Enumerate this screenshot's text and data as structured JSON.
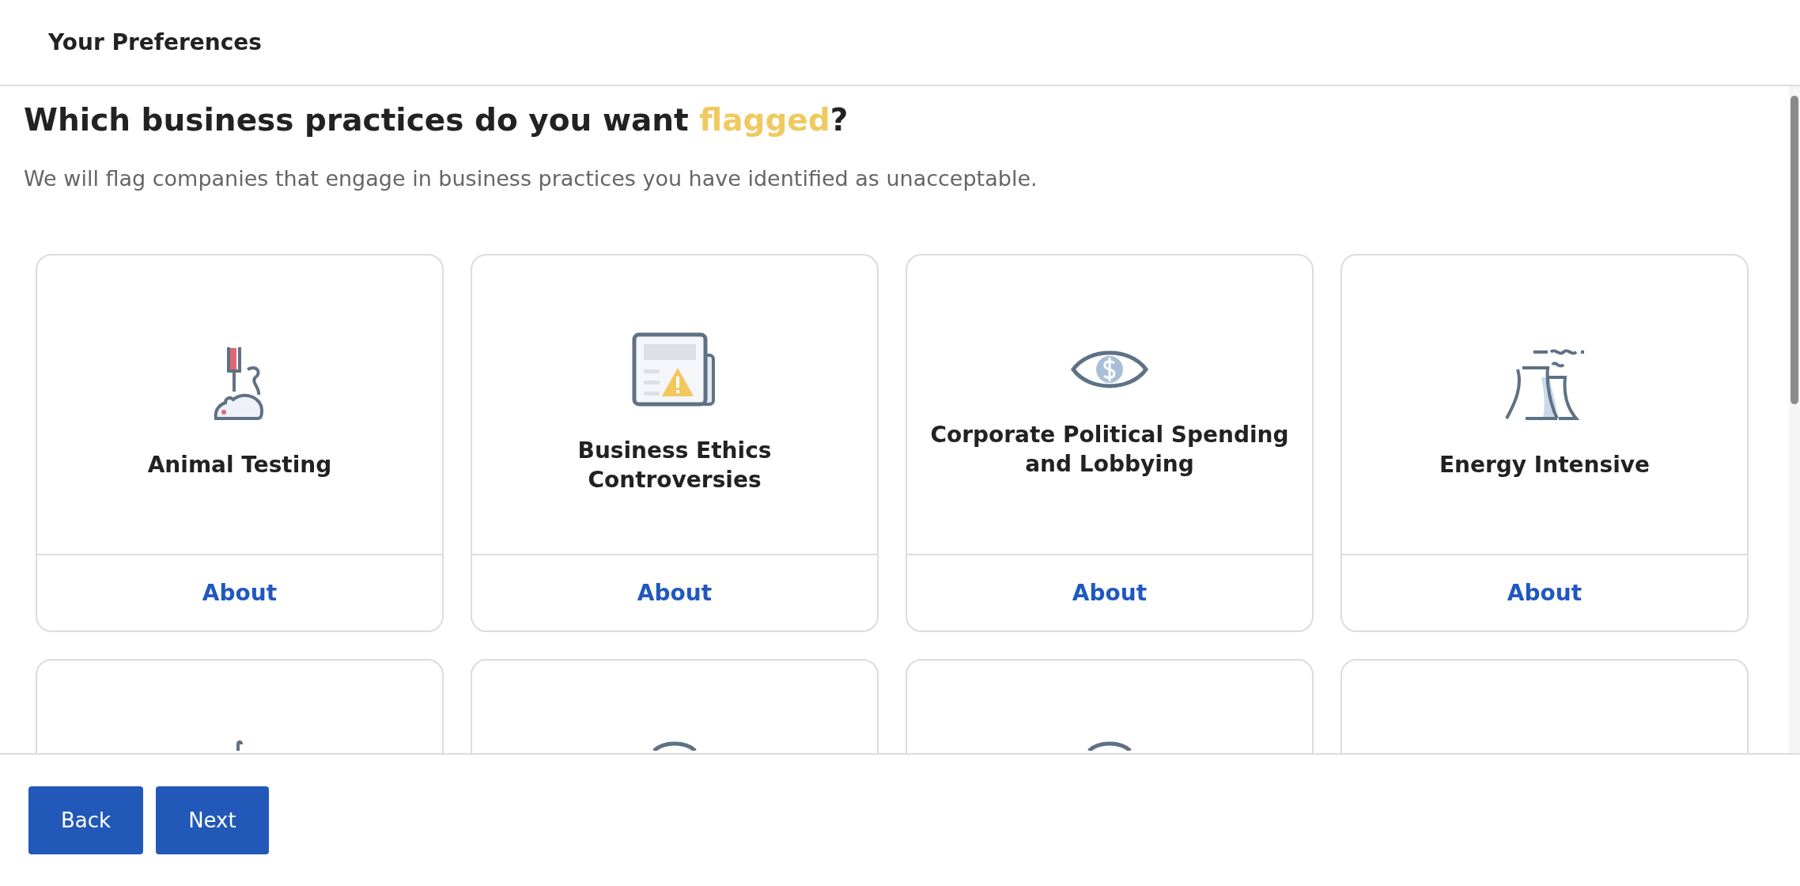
{
  "header": {
    "title": "Your Preferences"
  },
  "question": {
    "text": "Which business practices do you want ",
    "highlight": "flagged",
    "end": "?"
  },
  "subtitle": "We will flag companies that engage in business practices you have identified as unacceptable.",
  "cards": [
    {
      "kind": "full",
      "title": "Animal Testing",
      "link": "About"
    },
    {
      "kind": "full",
      "title": "Business Ethics Controversies",
      "link": "About"
    },
    {
      "kind": "full",
      "title": "Corporate Political Spending and Lobbying",
      "link": "About"
    },
    {
      "kind": "full",
      "title": "Energy Intensive",
      "link": "About"
    },
    {
      "kind": "partial"
    },
    {
      "kind": "partial"
    },
    {
      "kind": "partial"
    },
    {
      "kind": "partial"
    }
  ],
  "buttons": [
    "Back",
    "Next"
  ]
}
